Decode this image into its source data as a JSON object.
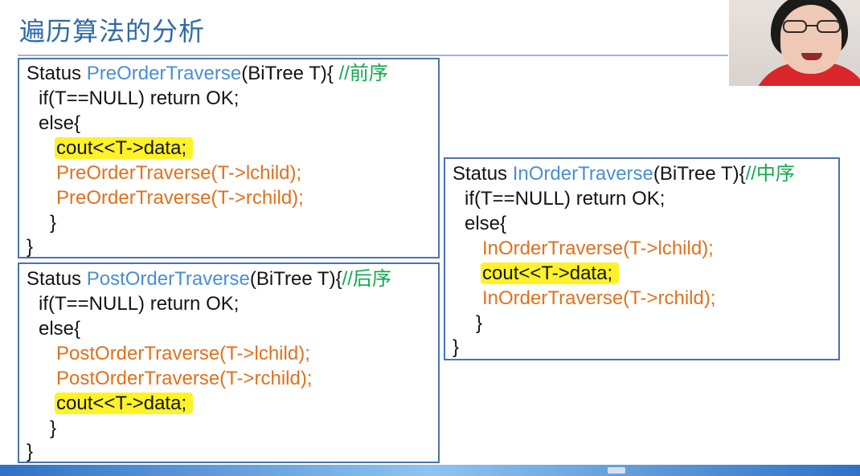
{
  "slide": {
    "title": "遍历算法的分析"
  },
  "preorder": {
    "l1_status": "Status ",
    "l1_fn": "PreOrderTraverse",
    "l1_param": "(BiTree T){ ",
    "l1_comment": "//前序",
    "l2": "if(T==NULL) return OK;",
    "l3": "else{",
    "l4_highlight": "cout<<T->data;",
    "l5": "PreOrderTraverse(T->lchild);",
    "l6": "PreOrderTraverse(T->rchild);",
    "l7": "}",
    "l8": "}"
  },
  "postorder": {
    "l1_status": "Status ",
    "l1_fn": "PostOrderTraverse",
    "l1_param": "(BiTree T){",
    "l1_comment": "//后序",
    "l2": "if(T==NULL) return OK;",
    "l3": "else{",
    "l4": "PostOrderTraverse(T->lchild);",
    "l5": "PostOrderTraverse(T->rchild);",
    "l6_highlight": "cout<<T->data;",
    "l7": "}",
    "l8": "}"
  },
  "inorder": {
    "l1_status": "Status ",
    "l1_fn": "InOrderTraverse",
    "l1_param": "(BiTree T){",
    "l1_comment": "//中序",
    "l2": "if(T==NULL) return OK;",
    "l3": "else{",
    "l4": "InOrderTraverse(T->lchild);",
    "l5_highlight": "cout<<T->data;",
    "l6": "InOrderTraverse(T->rchild);",
    "l7": "}",
    "l8": "}"
  },
  "colors": {
    "title": "#2e6aa8",
    "function_name": "#4a8fd0",
    "comment": "#13a84e",
    "recursive_call": "#e0711e",
    "highlight": "#fff227",
    "box_border": "#4a73ae"
  }
}
